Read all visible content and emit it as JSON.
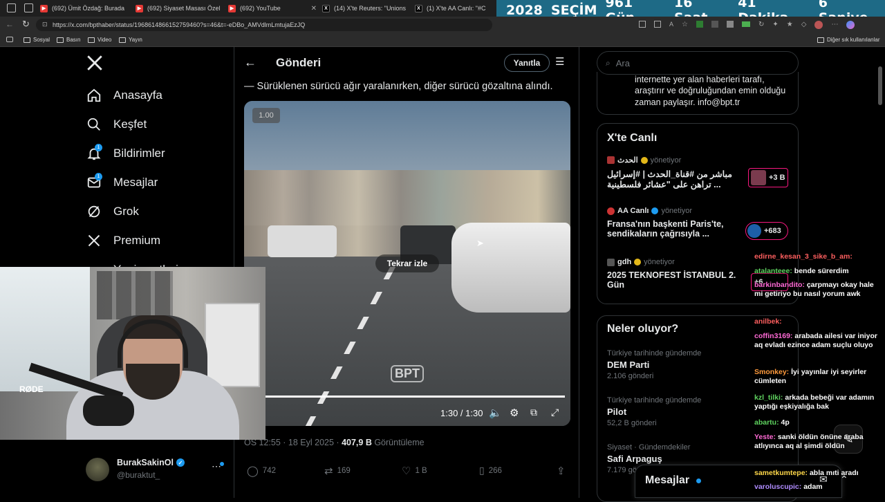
{
  "tabs": [
    {
      "label": "(692) Ümit Özdağ: Burada",
      "icon": "youtube-icon"
    },
    {
      "label": "(692) Siyaset Masası Özel",
      "icon": "youtube-icon"
    },
    {
      "label": "(692) YouTube",
      "icon": "youtube-icon"
    },
    {
      "label": "(14) X'te Reuters: \"Unions",
      "icon": "x-logo-icon"
    },
    {
      "label": "(1) X'te AA Canlı: \"#C",
      "icon": "x-logo-icon"
    }
  ],
  "countdown": {
    "l1": "2028",
    "l2": "SEÇİM",
    "l3": "961 Gün",
    "l4": "16 Saat",
    "l5": "41 Dakika",
    "l6": "6 Saniye"
  },
  "address": {
    "url": "https://x.com/bpthaber/status/1968614866152759460?s=46&t=-eDBo_AMVdlmLmtujaEzJQ"
  },
  "bookmarks": [
    "Sosyal",
    "Basın",
    "Video",
    "Yayın"
  ],
  "bookmarks_other": "Diğer sık kullanılanlar",
  "nav": {
    "home": "Anasayfa",
    "explore": "Keşfet",
    "notifications": "Bildirimler",
    "notifications_badge": "1",
    "messages": "Mesajlar",
    "messages_badge": "1",
    "grok": "Grok",
    "premium": "Premium",
    "partial": "Yer işaretleri"
  },
  "account": {
    "name": "BurakSakinOl",
    "handle": "@buraktut_"
  },
  "post": {
    "header": "Gönderi",
    "reply_button": "Yanıtla",
    "text": "— Sürüklenen sürücü ağır yaralanırken, diğer sürücü gözaltına alındı.",
    "speed": "1.00",
    "replay": "Tekrar izle",
    "watermark": "BPT",
    "time": "1:30 / 1:30",
    "progress": 1.0,
    "meta_time": "ÖS 12:55 · 18 Eyl 2025 · ",
    "views_count": "407,9 B",
    "views_label": "Görüntüleme",
    "replies": "742",
    "reposts": "169",
    "likes": "1 B",
    "bookmarks": "266"
  },
  "search": {
    "placeholder": "Ara"
  },
  "info_box": {
    "text1": "internette yer alan haberleri tarafı,",
    "text2": "araştırır ve doğruluğundan emin olduğu",
    "text3": "zaman paylaşır. info@bpt.tr"
  },
  "live": {
    "title": "X'te Canlı",
    "items": [
      {
        "host": "الحدث",
        "role": "yönetiyor",
        "title1": "مباشر من #قناة_الحدث | #إسرائيل",
        "title2": "تراهن على \"عشائر فلسطينية ...",
        "count": "+3 B"
      },
      {
        "host": "AA Canlı",
        "role": "yönetiyor",
        "title1": "Fransa'nın başkenti Paris'te,",
        "title2": "sendikaların çağrısıyla ...",
        "count": "+683"
      },
      {
        "host": "gdh",
        "role": "yönetiyor",
        "title1": "2025 TEKNOFEST İSTANBUL 2.",
        "title2": "Gün",
        "count": "+6"
      }
    ]
  },
  "trends": {
    "title": "Neler oluyor?",
    "items": [
      {
        "context": "Türkiye tarihinde gündemde",
        "name": "DEM Parti",
        "count": "2.106 gönderi"
      },
      {
        "context": "Türkiye tarihinde gündemde",
        "name": "Pilot",
        "count": "52,2 B gönderi"
      },
      {
        "context": "Siyaset · Gündemdekiler",
        "name": "Safi Arpaguş",
        "count": "7.179 gö"
      }
    ]
  },
  "messages_bar": {
    "label": "Mesajlar"
  },
  "chat": [
    {
      "user": "edirne_kesan_3_sike_b_am:",
      "msg": ""
    },
    {
      "user": "atalanteee:",
      "msg": "bende sürerdim"
    },
    {
      "user": "barkinbandito:",
      "msg": "çarpmayı okay hale mi getiriyo bu nasıl yorum awk"
    },
    {
      "user": "anilbek:",
      "msg": ""
    },
    {
      "user": "coffin3169:",
      "msg": "arabada ailesi var iniyor aq evladı ezince adam suçlu oluyo"
    },
    {
      "user": "Smonkey:",
      "msg": "İyi yayınlar iyi seyirler cümleten"
    },
    {
      "user": "kzl_tilki:",
      "msg": "arkada bebeği var adamın yaptığı eşkiyalığa bak"
    },
    {
      "user": "abartu:",
      "msg": "4p"
    },
    {
      "user": "Yeste:",
      "msg": "sanki öldün önüne araba atlıyınca aq al şimdi öldün"
    },
    {
      "user": "sametkumtepe:",
      "msg": "abla mıti aradı"
    },
    {
      "user": "varoluscupic:",
      "msg": "adam"
    }
  ],
  "webcam": {
    "mic_brand": "RØDE"
  }
}
